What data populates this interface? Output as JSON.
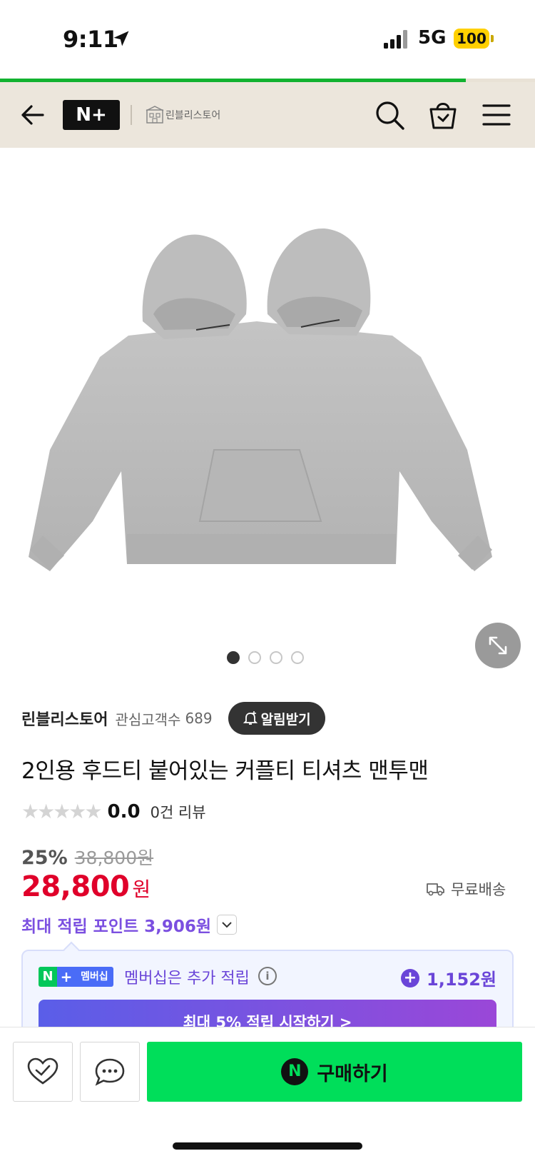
{
  "status_bar": {
    "time": "9:11",
    "network": "5G",
    "battery": "100"
  },
  "page_load_progress": 0.87,
  "header": {
    "brand_logo": "N+",
    "store_name": "린블리스토어"
  },
  "gallery": {
    "image_count": 4,
    "active_index": 0
  },
  "store": {
    "name": "린블리스토어",
    "watchers_label": "관심고객수",
    "watchers_count": "689",
    "alert_label": "알림받기"
  },
  "product": {
    "title": "2인용 후드티 붙어있는 커플티 티셔츠 맨투맨",
    "rating": "0.0",
    "review_count_label": "0건 리뷰",
    "discount_rate": "25%",
    "original_price": "38,800원",
    "sale_price": "28,800",
    "currency": "원",
    "shipping": "무료배송",
    "max_points": "최대 적립 포인트 3,906원"
  },
  "membership": {
    "badge_n": "N",
    "badge_plus": "+",
    "badge_label": "멤버십",
    "text": "멤버십은 추가 적립",
    "points": "1,152원",
    "cta": "최대 5% 적립 시작하기 >"
  },
  "bottom_bar": {
    "buy_label": "구매하기",
    "buy_icon_letter": "N"
  },
  "colors": {
    "accent_green": "#00de5a",
    "price_red": "#e0002a",
    "points_purple": "#7b4fe0",
    "header_bg": "#ece6dc"
  },
  "icons": [
    "location-arrow-icon",
    "signal-icon",
    "back-arrow-icon",
    "search-icon",
    "cart-icon",
    "menu-icon",
    "expand-icon",
    "bell-plus-icon",
    "star-icon",
    "truck-icon",
    "chevron-down-icon",
    "info-icon",
    "plus-circle-icon",
    "heart-check-icon",
    "chat-bubble-icon"
  ]
}
